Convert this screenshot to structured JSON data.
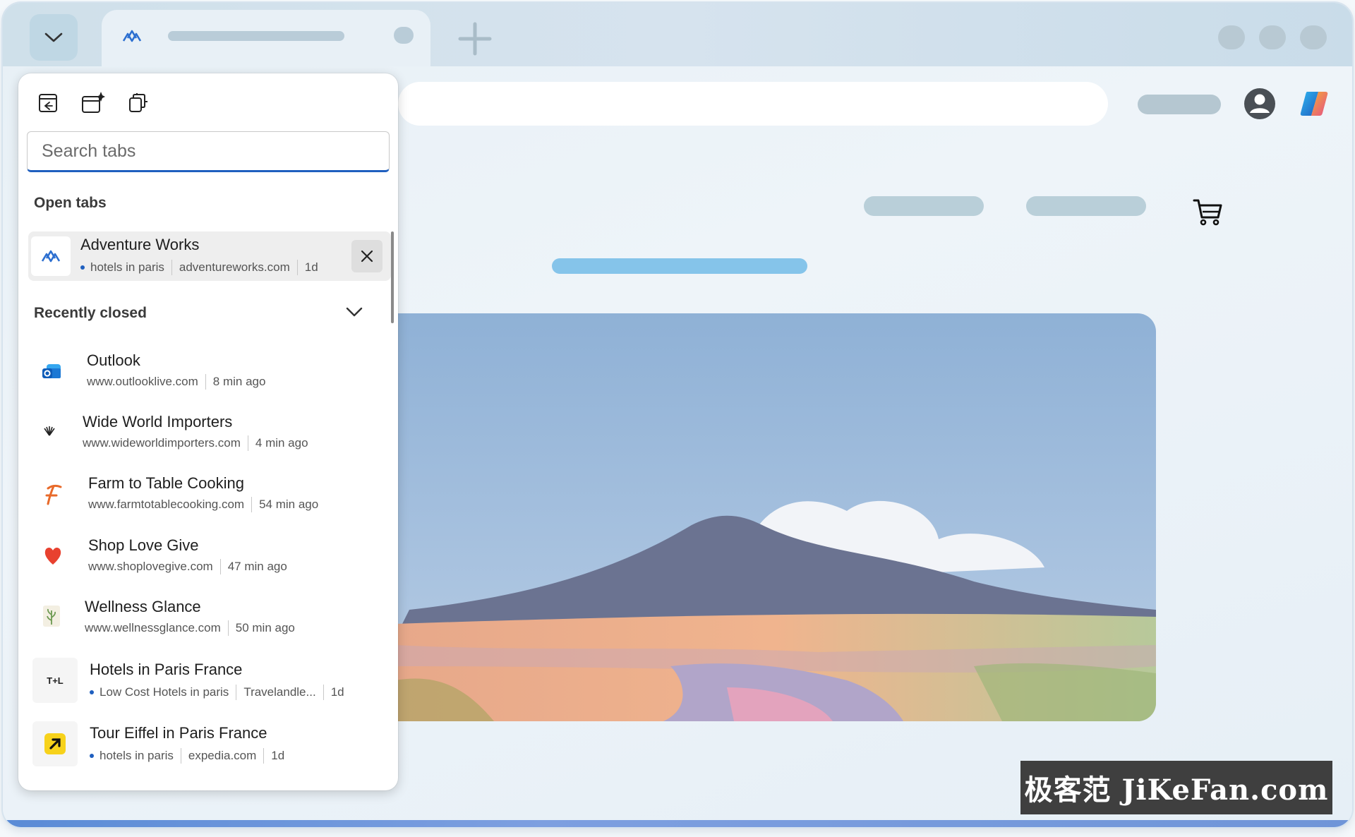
{
  "tab_search": {
    "placeholder": "Search tabs",
    "open_tabs_heading": "Open tabs",
    "recently_closed_heading": "Recently closed"
  },
  "open_tabs": [
    {
      "title": "Adventure Works",
      "query": "hotels in paris",
      "domain": "adventureworks.com",
      "time": "1d",
      "icon": "adventure-works-icon"
    }
  ],
  "recently_closed": [
    {
      "title": "Outlook",
      "domain": "www.outlooklive.com",
      "time": "8 min ago",
      "icon": "outlook-icon"
    },
    {
      "title": "Wide World Importers",
      "domain": "www.wideworldimporters.com",
      "time": "4 min ago",
      "icon": "wide-world-importers-icon"
    },
    {
      "title": "Farm to Table Cooking",
      "domain": "www.farmtotablecooking.com",
      "time": "54 min ago",
      "icon": "farm-to-table-icon"
    },
    {
      "title": "Shop Love Give",
      "domain": "www.shoplovegive.com",
      "time": "47 min ago",
      "icon": "heart-icon"
    },
    {
      "title": "Wellness Glance",
      "domain": "www.wellnessglance.com",
      "time": "50 min ago",
      "icon": "wellness-icon"
    },
    {
      "title": "Hotels in Paris France",
      "query": "Low Cost Hotels in paris",
      "domain": "Travelandle...",
      "time": "1d",
      "icon": "travel-leisure-icon",
      "icon_text": "T+L"
    },
    {
      "title": "Tour Eiffel in Paris France",
      "query": "hotels in paris",
      "domain": "expedia.com",
      "time": "1d",
      "icon": "expedia-icon"
    }
  ],
  "watermark": "极客范 JiKeFan.com",
  "colors": {
    "accent": "#1f5fbf",
    "heart": "#e8412f",
    "farm": "#e86a2a",
    "expedia": "#f7d21b"
  }
}
